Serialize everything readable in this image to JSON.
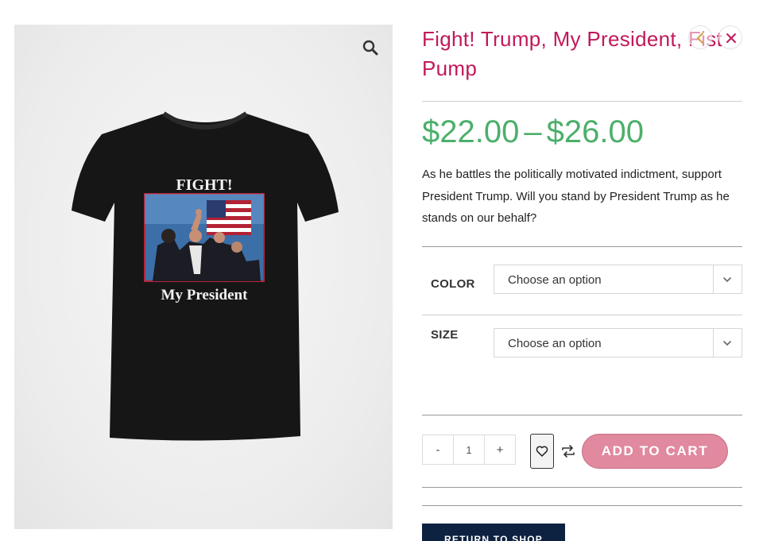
{
  "product": {
    "title": "Fight! Trump, My President, Fist Pump",
    "price_min": "$22.00",
    "price_sep": "–",
    "price_max": "$26.00",
    "description": "As he battles the politically motivated indictment, support President Trump. Will you stand by President Trump as he stands on our behalf?",
    "shirt_text_top": "FIGHT!",
    "shirt_text_bottom": "My President"
  },
  "variations": {
    "color_label": "COLOR",
    "color_value": "Choose an option",
    "size_label": "SIZE",
    "size_value": "Choose an option"
  },
  "cart": {
    "minus": "-",
    "quantity": "1",
    "plus": "+",
    "add_label": "ADD TO CART",
    "return_label": "RETURN TO SHOP"
  },
  "icons": {
    "zoom": "magnifier-icon",
    "prev": "chevron-left-icon",
    "next": "close-icon",
    "wishlist": "heart-icon",
    "compare": "compare-arrows-icon",
    "select": "chevron-down-icon"
  },
  "colors": {
    "title": "#c2185b",
    "price": "#4caf6a",
    "cart_button": "#e0899f",
    "return_button": "#0d2240"
  }
}
